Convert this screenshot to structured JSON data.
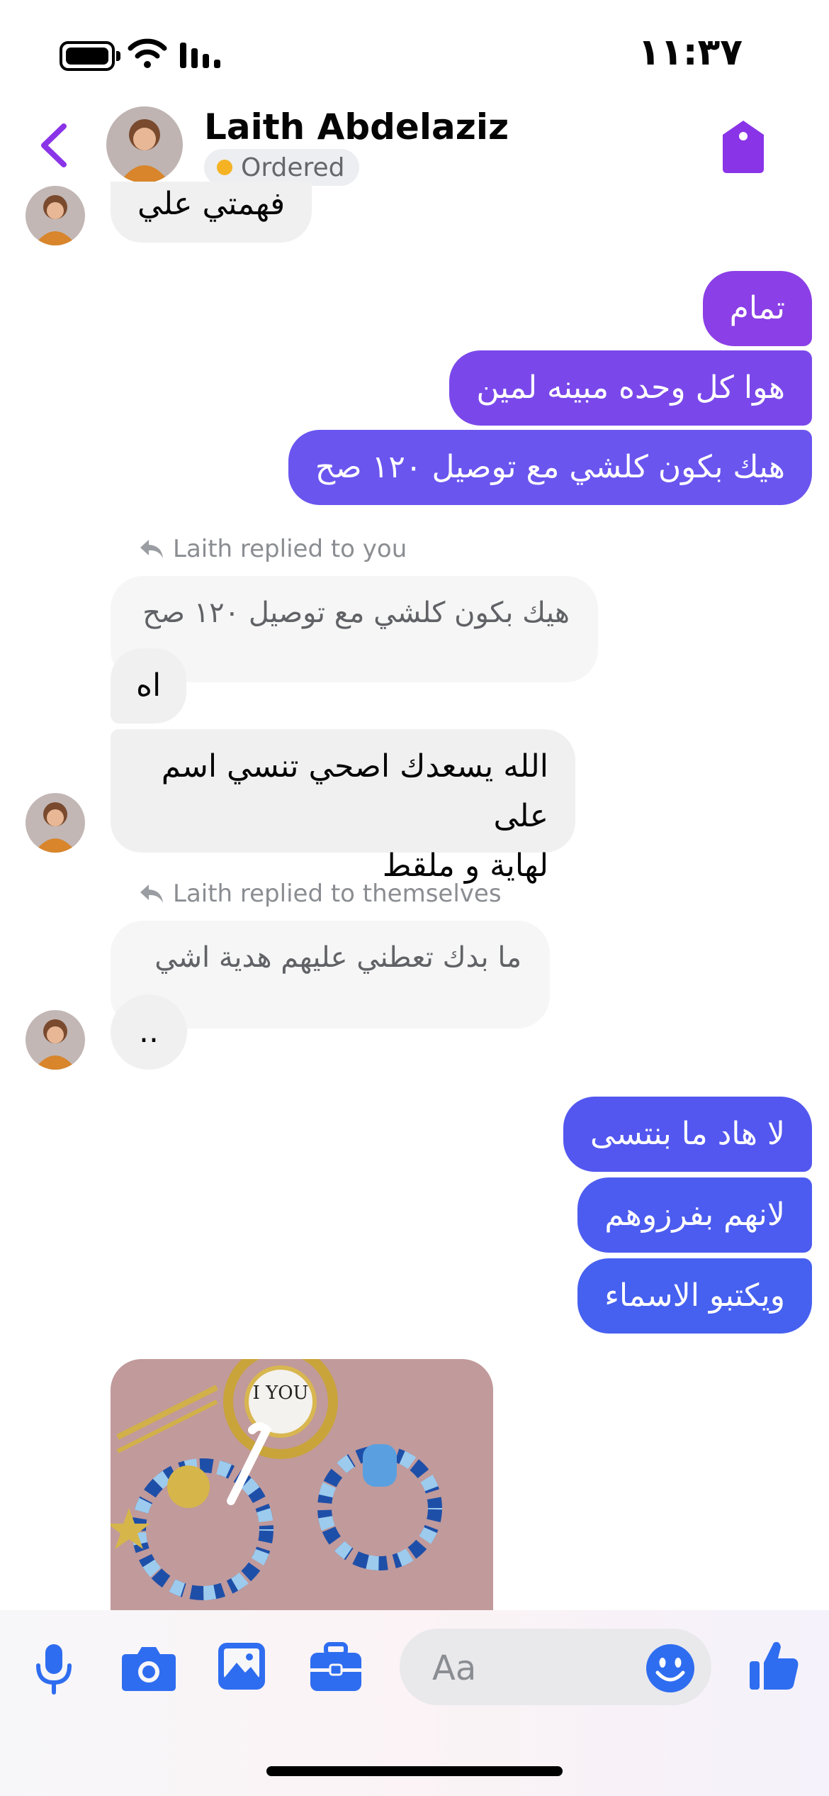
{
  "status_bar": {
    "time": "١١:٣٧"
  },
  "header": {
    "contact_name": "Laith Abdelaziz",
    "status_label": "Ordered",
    "status_color": "#f5b324",
    "accent": "#8a34e8"
  },
  "messages": {
    "m1": "فهمتي علي",
    "m2": "تمام",
    "m3": "هوا كل وحده مبينه لمين",
    "m4": "هيك بكون كلشي مع توصيل ١٢٠ صح",
    "reply1_note": "Laith replied to you",
    "reply1_quote": "هيك بكون كلشي مع توصيل ١٢٠ صح",
    "m5": "اه",
    "m6_line1": "الله يسعدك اصحي تنسي اسم على",
    "m6_line2": "لهاية و ملقط",
    "reply2_note": "Laith replied to themselves",
    "reply2_quote": "ما بدك تعطني عليهم هدية اشي",
    "m7": "..",
    "m8": "لا هاد ما بنتسى",
    "m9": "لانهم بفرزوهم",
    "m10": "ويكتبو الاسماء",
    "photo_caption": "I YOU"
  },
  "composer": {
    "placeholder": "Aa"
  },
  "colors": {
    "bubble_purple": "#8b3fe6",
    "bubble_indigo": "#6a55ef",
    "bubble_blue": "#4c5cf0",
    "icon_blue": "#2f6df0"
  }
}
